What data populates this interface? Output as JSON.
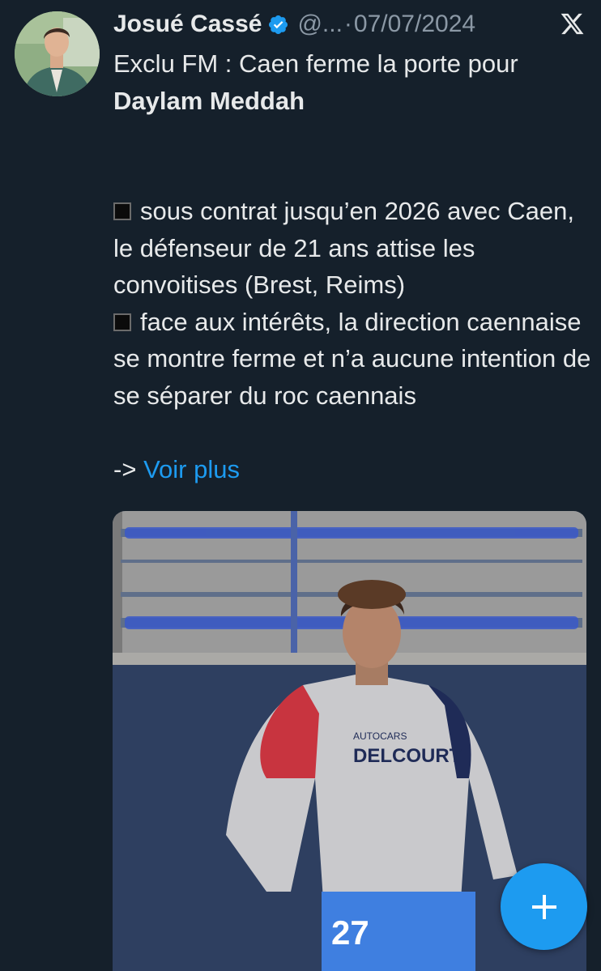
{
  "author": {
    "name": "Josué Cassé",
    "handle": "@...",
    "separator": "·",
    "date": "07/07/2024"
  },
  "tweet": {
    "line1": "Exclu FM : Caen ferme la porte pour",
    "line2": "Daylam Meddah",
    "bullet1": "sous contrat jusqu’en 2026 avec Caen, le défenseur de 21 ans attise les convoitises (Brest, Reims)",
    "bullet2": "face aux intérêts, la direction caennaise se montre ferme et n’a aucune intention de se séparer du roc caennais",
    "arrow": "->",
    "link_text": "Voir plus"
  },
  "photo": {
    "sponsor_line1": "AUTOCARS",
    "sponsor_line2": "DELCOURT",
    "shirt_number": "27"
  },
  "colors": {
    "background": "#15202b",
    "accent": "#1d9bf0",
    "verified": "#1d9bf0"
  },
  "icons": {
    "verified": "verified-badge-icon",
    "platform": "x-logo-icon",
    "compose": "plus-icon"
  }
}
